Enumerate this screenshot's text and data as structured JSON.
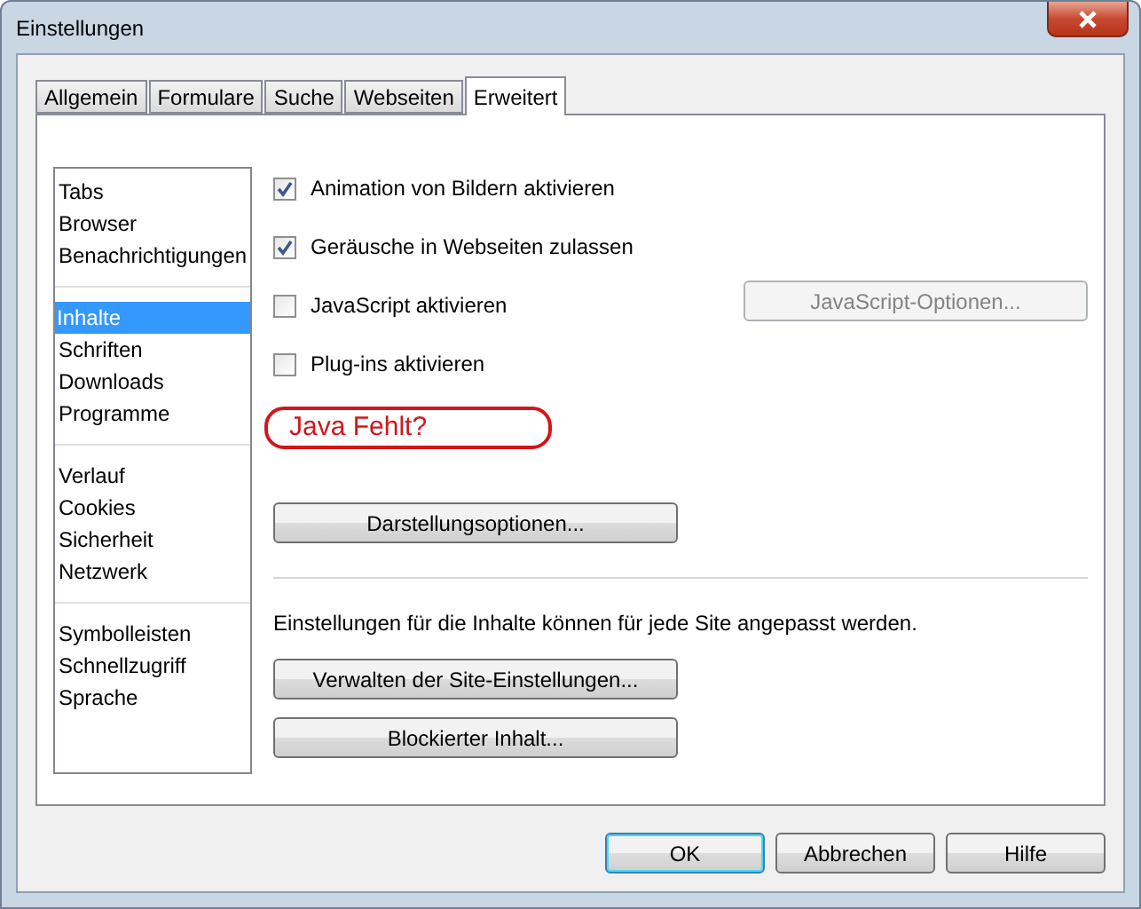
{
  "window": {
    "title": "Einstellungen"
  },
  "tabs": [
    {
      "label": "Allgemein",
      "selected": false
    },
    {
      "label": "Formulare",
      "selected": false
    },
    {
      "label": "Suche",
      "selected": false
    },
    {
      "label": "Webseiten",
      "selected": false
    },
    {
      "label": "Erweitert",
      "selected": true
    }
  ],
  "sidebar": {
    "groups": [
      {
        "items": [
          {
            "label": "Tabs",
            "selected": false
          },
          {
            "label": "Browser",
            "selected": false
          },
          {
            "label": "Benachrichtigungen",
            "selected": false
          }
        ]
      },
      {
        "items": [
          {
            "label": "Inhalte",
            "selected": true
          },
          {
            "label": "Schriften",
            "selected": false
          },
          {
            "label": "Downloads",
            "selected": false
          },
          {
            "label": "Programme",
            "selected": false
          }
        ]
      },
      {
        "items": [
          {
            "label": "Verlauf",
            "selected": false
          },
          {
            "label": "Cookies",
            "selected": false
          },
          {
            "label": "Sicherheit",
            "selected": false
          },
          {
            "label": "Netzwerk",
            "selected": false
          }
        ]
      },
      {
        "items": [
          {
            "label": "Symbolleisten",
            "selected": false
          },
          {
            "label": "Schnellzugriff",
            "selected": false
          },
          {
            "label": "Sprache",
            "selected": false
          }
        ]
      }
    ]
  },
  "options": [
    {
      "label": "Animation von Bildern aktivieren",
      "checked": true
    },
    {
      "label": "Geräusche in Webseiten zulassen",
      "checked": true
    },
    {
      "label": "JavaScript aktivieren",
      "checked": false,
      "button": {
        "label": "JavaScript-Optionen...",
        "disabled": true
      }
    },
    {
      "label": "Plug-ins aktivieren",
      "checked": false
    }
  ],
  "annotation": {
    "text": "Java Fehlt?"
  },
  "display_button": {
    "label": "Darstellungsoptionen..."
  },
  "site_note": "Einstellungen für die Inhalte können für jede Site angepasst werden.",
  "site_buttons": [
    {
      "label": "Verwalten der Site-Einstellungen..."
    },
    {
      "label": "Blockierter Inhalt..."
    }
  ],
  "footer_buttons": [
    {
      "label": "OK",
      "default": true
    },
    {
      "label": "Abbrechen",
      "default": false
    },
    {
      "label": "Hilfe",
      "default": false
    }
  ]
}
